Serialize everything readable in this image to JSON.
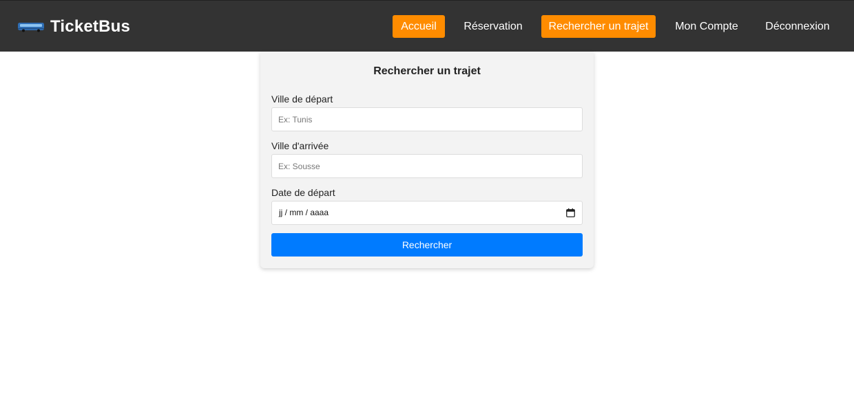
{
  "header": {
    "brand": "TicketBus",
    "brand_icon": "bus-icon",
    "nav": [
      {
        "label": "Accueil",
        "active": true
      },
      {
        "label": "Réservation",
        "active": false
      },
      {
        "label": "Rechercher un trajet",
        "active": true
      },
      {
        "label": "Mon Compte",
        "active": false
      },
      {
        "label": "Déconnexion",
        "active": false
      }
    ],
    "colors": {
      "background": "#333333",
      "active": "#ff8c00",
      "text": "#ffffff"
    }
  },
  "form": {
    "title": "Rechercher un trajet",
    "departure": {
      "label": "Ville de départ",
      "placeholder": "Ex: Tunis",
      "value": ""
    },
    "arrival": {
      "label": "Ville d'arrivée",
      "placeholder": "Ex: Sousse",
      "value": ""
    },
    "date": {
      "label": "Date de départ",
      "placeholder": "jj / mm / aaaa",
      "icon": "calendar-icon"
    },
    "submit_label": "Rechercher",
    "colors": {
      "card": "#f3f3f3",
      "button": "#007bff"
    }
  }
}
